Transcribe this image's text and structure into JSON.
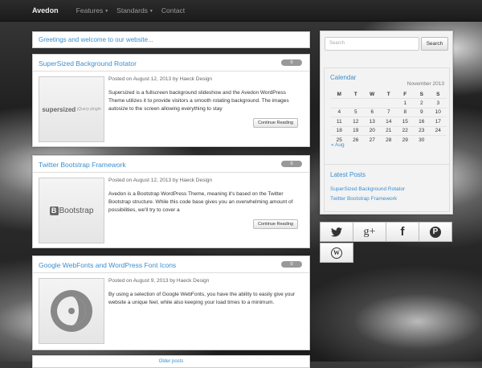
{
  "navbar": {
    "brand": "Avedon",
    "items": [
      {
        "label": "Features",
        "dropdown": true
      },
      {
        "label": "Standards",
        "dropdown": true
      },
      {
        "label": "Contact",
        "dropdown": false
      }
    ]
  },
  "welcome": "Greetings and welcome to our website...",
  "posts": [
    {
      "title": "SuperSized Background Rotator",
      "count": "0",
      "meta": "Posted on August 12, 2013 by Haeck Design",
      "excerpt": "Supersized is a fullscreen background slideshow and the Avedon WordPress Theme utilizes it to provide visitors a smooth rotating background. The images autosize to the screen allowing everything to stay",
      "button": "Continue Reading",
      "thumb_text": "supersized",
      "thumb_sub": "jQuery plugin"
    },
    {
      "title": "Twitter Bootstrap Framework",
      "count": "0",
      "meta": "Posted on August 12, 2013 by Haeck Design",
      "excerpt": "Avedon is a Bootstrap WordPress Theme, meaning it's based on the Twitter Bootstrap structure. While this code base gives you an overwhelming amount of possibilities, we'll try to cover a",
      "button": "Continue Reading",
      "thumb_text": "Bootstrap"
    },
    {
      "title": "Google WebFonts and WordPress Font Icons",
      "count": "0",
      "meta": "Posted on August 9, 2013 by Haeck Design",
      "excerpt": "By using a selection of Google WebFonts, you have the ability to easily give your website a unique feel, while also keeping your load times to a minimum."
    }
  ],
  "older_posts": "Older posts",
  "search": {
    "placeholder": "Search",
    "button": "Search"
  },
  "calendar": {
    "title": "Calendar",
    "month": "November 2013",
    "weekdays": [
      "M",
      "T",
      "W",
      "T",
      "F",
      "S",
      "S"
    ],
    "weeks": [
      [
        "",
        "",
        "",
        "",
        "1",
        "2",
        "3"
      ],
      [
        "4",
        "5",
        "6",
        "7",
        "8",
        "9",
        "10"
      ],
      [
        "11",
        "12",
        "13",
        "14",
        "15",
        "16",
        "17"
      ],
      [
        "18",
        "19",
        "20",
        "21",
        "22",
        "23",
        "24"
      ],
      [
        "25",
        "26",
        "27",
        "28",
        "29",
        "30",
        ""
      ]
    ],
    "prev": "« Aug"
  },
  "latest": {
    "title": "Latest Posts",
    "items": [
      "SuperSized Background Rotator",
      "Twitter Bootstrap Framework"
    ]
  },
  "social": [
    {
      "icon": "twitter-icon"
    },
    {
      "icon": "google-plus-icon",
      "glyph": "g+"
    },
    {
      "icon": "facebook-icon",
      "glyph": "f"
    },
    {
      "icon": "pinterest-icon",
      "glyph": "P"
    },
    {
      "icon": "wordpress-icon",
      "glyph": "W"
    }
  ],
  "colors": {
    "link": "#3a8fd0",
    "navbar": "#1b1b1b",
    "badge": "#999999"
  }
}
